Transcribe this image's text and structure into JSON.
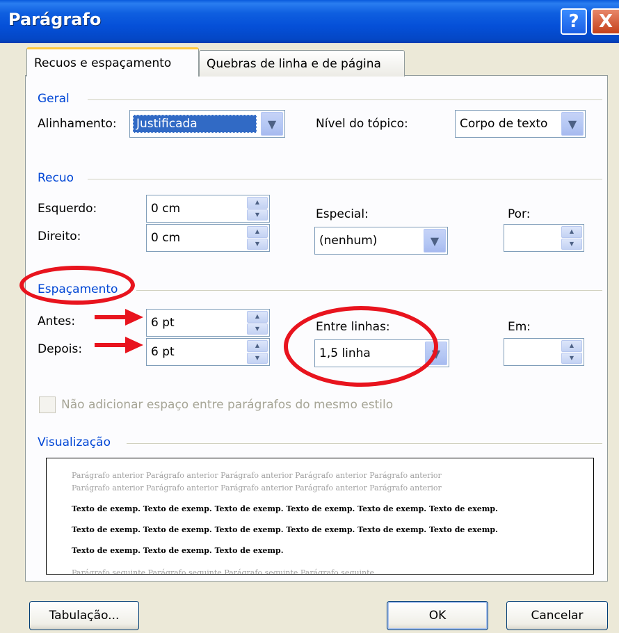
{
  "window": {
    "title": "Parágrafo",
    "help_label": "?",
    "close_label": "X"
  },
  "tabs": [
    {
      "label": "Recuos e espaçamento",
      "active": true
    },
    {
      "label": "Quebras de linha e de página",
      "active": false
    }
  ],
  "geral": {
    "section": "Geral",
    "alinhamento_label": "Alinhamento:",
    "alinhamento_value": "Justificada",
    "nivel_label": "Nível do tópico:",
    "nivel_value": "Corpo de texto"
  },
  "recuo": {
    "section": "Recuo",
    "esquerdo_label": "Esquerdo:",
    "esquerdo_value": "0 cm",
    "direito_label": "Direito:",
    "direito_value": "0 cm",
    "especial_label": "Especial:",
    "especial_value": "(nenhum)",
    "por_label": "Por:",
    "por_value": ""
  },
  "espacamento": {
    "section": "Espaçamento",
    "antes_label": "Antes:",
    "antes_value": "6 pt",
    "depois_label": "Depois:",
    "depois_value": "6 pt",
    "entre_label": "Entre linhas:",
    "entre_value": "1,5 linha",
    "em_label": "Em:",
    "em_value": "",
    "checkbox_label": "Não adicionar espaço entre parágrafos do mesmo estilo",
    "checkbox_checked": false
  },
  "visualizacao": {
    "section": "Visualização",
    "prev_line_1": "Parágrafo anterior Parágrafo anterior Parágrafo anterior Parágrafo anterior Parágrafo anterior",
    "prev_line_2": "Parágrafo anterior Parágrafo anterior Parágrafo anterior Parágrafo anterior Parágrafo anterior",
    "sample_line_1": "Texto de exemp. Texto de exemp. Texto de exemp. Texto de exemp. Texto de exemp. Texto de exemp.",
    "sample_line_2": "Texto de exemp. Texto de exemp. Texto de exemp. Texto de exemp. Texto de exemp. Texto de exemp.",
    "sample_line_3": "Texto de exemp. Texto de exemp. Texto de exemp.",
    "next_line_1": "Parágrafo seguinte Parágrafo seguinte Parágrafo seguinte Parágrafo seguinte"
  },
  "buttons": {
    "tabulacao": "Tabulação...",
    "ok": "OK",
    "cancelar": "Cancelar"
  },
  "icons": {
    "dropdown": "chevron-down-icon",
    "spin": "spin-arrows-icon"
  },
  "colors": {
    "annotation": "#e8141e",
    "titlebar": "#0550d8",
    "section_heading": "#0046d5"
  }
}
